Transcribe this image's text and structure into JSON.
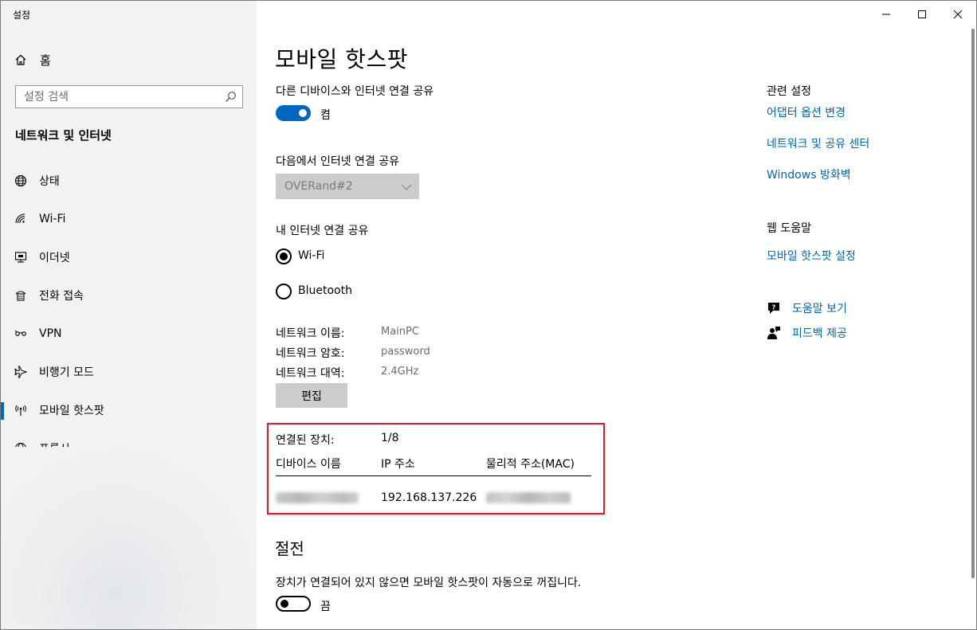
{
  "window": {
    "title": "설정"
  },
  "sidebar": {
    "home_label": "홈",
    "search_placeholder": "설정 검색",
    "section_title": "네트워크 및 인터넷",
    "items": [
      {
        "label": "상태",
        "icon": "globe-status-icon"
      },
      {
        "label": "Wi-Fi",
        "icon": "wifi-icon"
      },
      {
        "label": "이더넷",
        "icon": "ethernet-icon"
      },
      {
        "label": "전화 접속",
        "icon": "dialup-icon"
      },
      {
        "label": "VPN",
        "icon": "vpn-icon"
      },
      {
        "label": "비행기 모드",
        "icon": "airplane-icon"
      },
      {
        "label": "모바일 핫스팟",
        "icon": "hotspot-icon",
        "active": true
      },
      {
        "label": "프록시",
        "icon": "globe-proxy-icon"
      }
    ]
  },
  "main": {
    "title": "모바일 핫스팟",
    "share_label": "다른 디바이스와 인터넷 연결 공유",
    "share_toggle_state": "켬",
    "share_from_label": "다음에서 인터넷 연결 공유",
    "share_from_value": "OVERand#2",
    "share_over_label": "내 인터넷 연결 공유",
    "radio_wifi": "Wi-Fi",
    "radio_bluetooth": "Bluetooth",
    "network_name_label": "네트워크 이름:",
    "network_name_value": "MainPC",
    "network_password_label": "네트워크 암호:",
    "network_password_value": "password",
    "network_band_label": "네트워크 대역:",
    "network_band_value": "2.4GHz",
    "edit_button": "편집",
    "connected_label": "연결된 장치:",
    "connected_value": "1/8",
    "table_headers": [
      "디바이스 이름",
      "IP 주소",
      "물리적 주소(MAC)"
    ],
    "table_row_ip": "192.168.137.226",
    "power_title": "절전",
    "power_desc": "장치가 연결되어 있지 않으면 모바일 핫스팟이 자동으로 꺼집니다.",
    "power_toggle_state": "끔"
  },
  "related": {
    "heading": "관련 설정",
    "links": [
      "어댑터 옵션 변경",
      "네트워크 및 공유 센터",
      "Windows 방화벽"
    ],
    "web_help_heading": "웹 도움말",
    "web_help_link": "모바일 핫스팟 설정",
    "get_help": "도움말 보기",
    "give_feedback": "피드백 제공"
  },
  "colors": {
    "accent": "#0067c0",
    "link": "#0063b1",
    "highlight_border": "#d4202a"
  }
}
